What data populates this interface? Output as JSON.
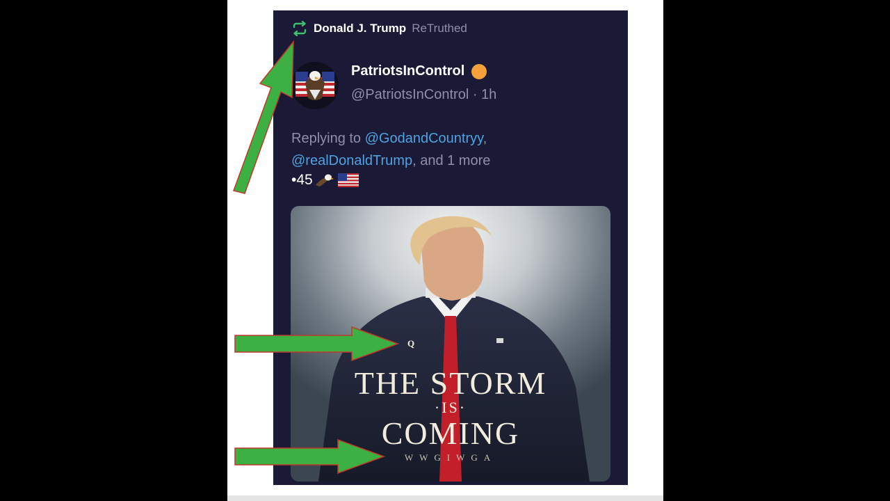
{
  "retruth": {
    "user": "Donald J. Trump",
    "label": "ReTruthed"
  },
  "author": {
    "display_name": "PatriotsInControl",
    "handle": "@PatriotsInControl",
    "time": "· 1h"
  },
  "reply": {
    "prefix": "Replying to",
    "mention_1": "@GodandCountryy",
    "sep_1": ",",
    "mention_2": "@realDonaldTrump",
    "suffix": ", and 1 more"
  },
  "post_text": "•45",
  "image_caption": {
    "q_mark": "Q",
    "line1": "THE STORM",
    "line2": "·IS·",
    "line3": "COMING",
    "line4": "WWGIWGA"
  },
  "colors": {
    "background": "#000000",
    "post_bg": "#1a1a36",
    "mention": "#4fa3e0",
    "retruth_icon": "#3fbf6f",
    "annotation_arrow": "#3cb043"
  },
  "icons": {
    "retruth": "retruth-icon",
    "verified": "verified-badge-icon",
    "eagle": "eagle-icon",
    "flag": "us-flag-icon"
  }
}
